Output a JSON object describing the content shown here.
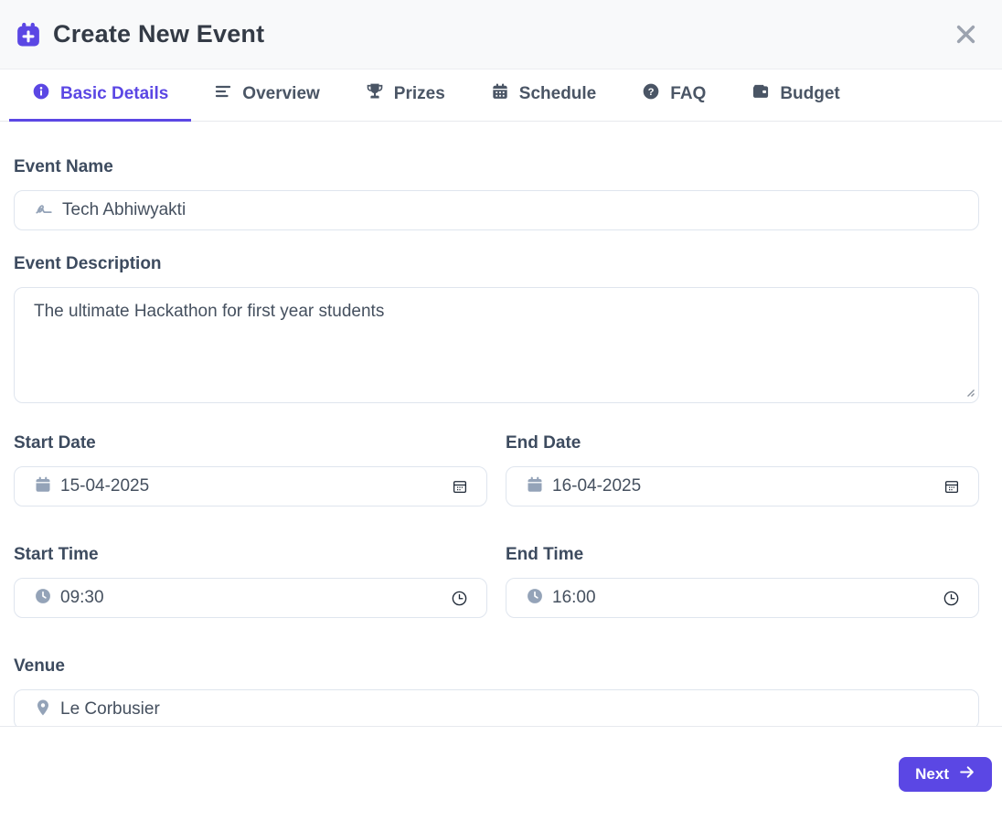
{
  "window": {
    "title": "Create New Event"
  },
  "tabs": [
    {
      "label": "Basic Details",
      "icon": "info-circle",
      "active": true
    },
    {
      "label": "Overview",
      "icon": "align-left",
      "active": false
    },
    {
      "label": "Prizes",
      "icon": "trophy",
      "active": false
    },
    {
      "label": "Schedule",
      "icon": "calendar-grid",
      "active": false
    },
    {
      "label": "FAQ",
      "icon": "question-circle",
      "active": false
    },
    {
      "label": "Budget",
      "icon": "wallet",
      "active": false
    }
  ],
  "form": {
    "event_name": {
      "label": "Event Name",
      "value": "Tech Abhiwyakti"
    },
    "event_description": {
      "label": "Event Description",
      "value": "The ultimate Hackathon for first year students"
    },
    "start_date": {
      "label": "Start Date",
      "value": "15-04-2025"
    },
    "end_date": {
      "label": "End Date",
      "value": "16-04-2025"
    },
    "start_time": {
      "label": "Start Time",
      "value": "09:30"
    },
    "end_time": {
      "label": "End Time",
      "value": "16:00"
    },
    "venue": {
      "label": "Venue",
      "value": "Le Corbusier"
    }
  },
  "footer": {
    "next_label": "Next"
  },
  "colors": {
    "accent": "#5b47e4",
    "tab_inactive": "#4a5565",
    "label_text": "#3d4b5f",
    "input_icon": "#94a3b8",
    "close_icon": "#9ca3af",
    "header_bg": "#f8f9fa"
  }
}
